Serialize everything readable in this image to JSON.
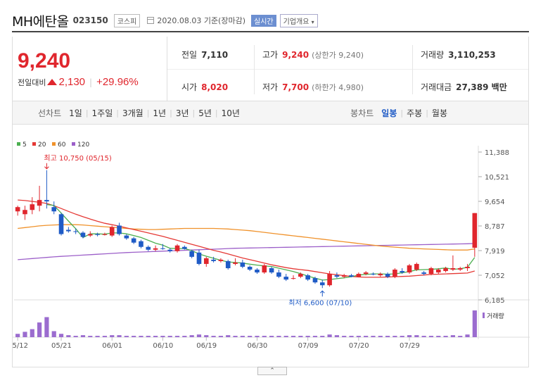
{
  "header": {
    "name": "MH에탄올",
    "code": "023150",
    "market": "코스피",
    "date": "2020.08.03 기준(장마감)",
    "realtime": "실시간",
    "company_info": "기업개요"
  },
  "summary": {
    "price": "9,240",
    "change_label": "전일대비",
    "change": "2,130",
    "change_pct": "+29.96%",
    "prev_close_label": "전일",
    "prev_close": "7,110",
    "open_label": "시가",
    "open": "8,020",
    "high_label": "고가",
    "high": "9,240",
    "high_limit": "(상한가 9,240)",
    "low_label": "저가",
    "low": "7,700",
    "low_limit": "(하한가 4,980)",
    "volume_label": "거래량",
    "volume": "3,110,253",
    "amount_label": "거래대금",
    "amount": "27,389 백만"
  },
  "tabs": {
    "line_label": "선차트",
    "periods": [
      "1일",
      "1주일",
      "3개월",
      "1년",
      "3년",
      "5년",
      "10년"
    ],
    "candle_label": "봉차트",
    "candles": [
      "일봉",
      "주봉",
      "월봉"
    ],
    "active_candle": "일봉"
  },
  "colors": {
    "up": "#e0262d",
    "down": "#1f5bc6",
    "ma5": "#4caf50",
    "ma20": "#e53935",
    "ma60": "#f0922b",
    "ma120": "#9c5fc9"
  },
  "chart_data": {
    "type": "candlestick",
    "legend": [
      "5",
      "20",
      "60",
      "120"
    ],
    "y_ticks": [
      "11,388",
      "10,521",
      "9,654",
      "8,787",
      "7,919",
      "7,052",
      "6,185"
    ],
    "ylim": [
      6185,
      11388
    ],
    "x_ticks": [
      "05/12",
      "05/21",
      "06/01",
      "06/10",
      "06/19",
      "06/30",
      "07/09",
      "07/20",
      "07/29"
    ],
    "annotations": {
      "max": "최고 10,750 (05/15)",
      "min": "최저 6,600 (07/10)"
    },
    "volume_label": "거래량",
    "candles": [
      {
        "o": 9300,
        "h": 9500,
        "l": 9150,
        "c": 9450
      },
      {
        "o": 9200,
        "h": 9500,
        "l": 9000,
        "c": 9350
      },
      {
        "o": 9350,
        "h": 9800,
        "l": 9200,
        "c": 9550
      },
      {
        "o": 9500,
        "h": 10200,
        "l": 9300,
        "c": 9700
      },
      {
        "o": 9700,
        "h": 10750,
        "l": 9400,
        "c": 9650
      },
      {
        "o": 9450,
        "h": 9650,
        "l": 9200,
        "c": 9300
      },
      {
        "o": 9200,
        "h": 9250,
        "l": 8450,
        "c": 8500
      },
      {
        "o": 8650,
        "h": 8750,
        "l": 8550,
        "c": 8600
      },
      {
        "o": 8600,
        "h": 8700,
        "l": 8500,
        "c": 8580
      },
      {
        "o": 8550,
        "h": 8600,
        "l": 8350,
        "c": 8400
      },
      {
        "o": 8450,
        "h": 8600,
        "l": 8400,
        "c": 8500
      },
      {
        "o": 8500,
        "h": 8550,
        "l": 8420,
        "c": 8470
      },
      {
        "o": 8470,
        "h": 8550,
        "l": 8450,
        "c": 8500
      },
      {
        "o": 8450,
        "h": 8800,
        "l": 8400,
        "c": 8750
      },
      {
        "o": 8800,
        "h": 8900,
        "l": 8450,
        "c": 8500
      },
      {
        "o": 8450,
        "h": 8500,
        "l": 8300,
        "c": 8350
      },
      {
        "o": 8350,
        "h": 8400,
        "l": 8150,
        "c": 8200
      },
      {
        "o": 8250,
        "h": 8300,
        "l": 8000,
        "c": 8050
      },
      {
        "o": 8050,
        "h": 8100,
        "l": 7900,
        "c": 7950
      },
      {
        "o": 7950,
        "h": 8100,
        "l": 7900,
        "c": 8000
      },
      {
        "o": 8000,
        "h": 8150,
        "l": 7950,
        "c": 7980
      },
      {
        "o": 7950,
        "h": 8000,
        "l": 7850,
        "c": 7900
      },
      {
        "o": 7900,
        "h": 8150,
        "l": 7850,
        "c": 8100
      },
      {
        "o": 8050,
        "h": 8100,
        "l": 7950,
        "c": 7980
      },
      {
        "o": 7900,
        "h": 7950,
        "l": 7650,
        "c": 7700
      },
      {
        "o": 7850,
        "h": 7950,
        "l": 7400,
        "c": 7450
      },
      {
        "o": 7450,
        "h": 7700,
        "l": 7350,
        "c": 7650
      },
      {
        "o": 7600,
        "h": 7700,
        "l": 7500,
        "c": 7550
      },
      {
        "o": 7550,
        "h": 7650,
        "l": 7500,
        "c": 7600
      },
      {
        "o": 7550,
        "h": 7600,
        "l": 7250,
        "c": 7300
      },
      {
        "o": 7450,
        "h": 7650,
        "l": 7400,
        "c": 7500
      },
      {
        "o": 7500,
        "h": 7600,
        "l": 7300,
        "c": 7350
      },
      {
        "o": 7350,
        "h": 7400,
        "l": 7200,
        "c": 7250
      },
      {
        "o": 7250,
        "h": 7300,
        "l": 7100,
        "c": 7150
      },
      {
        "o": 7150,
        "h": 7450,
        "l": 7100,
        "c": 7400
      },
      {
        "o": 7300,
        "h": 7350,
        "l": 7100,
        "c": 7150
      },
      {
        "o": 7150,
        "h": 7250,
        "l": 6950,
        "c": 7000
      },
      {
        "o": 7000,
        "h": 7100,
        "l": 6850,
        "c": 6900
      },
      {
        "o": 6950,
        "h": 7050,
        "l": 6900,
        "c": 6950
      },
      {
        "o": 7000,
        "h": 7150,
        "l": 6950,
        "c": 7100
      },
      {
        "o": 7050,
        "h": 7100,
        "l": 6850,
        "c": 6900
      },
      {
        "o": 6950,
        "h": 7000,
        "l": 6750,
        "c": 6800
      },
      {
        "o": 6800,
        "h": 6900,
        "l": 6600,
        "c": 6700
      },
      {
        "o": 6700,
        "h": 7200,
        "l": 6650,
        "c": 7100
      },
      {
        "o": 7050,
        "h": 7150,
        "l": 6950,
        "c": 7000
      },
      {
        "o": 7000,
        "h": 7100,
        "l": 6950,
        "c": 7050
      },
      {
        "o": 7050,
        "h": 7100,
        "l": 6980,
        "c": 7000
      },
      {
        "o": 7000,
        "h": 7150,
        "l": 6980,
        "c": 7100
      },
      {
        "o": 7100,
        "h": 7200,
        "l": 7050,
        "c": 7150
      },
      {
        "o": 7100,
        "h": 7150,
        "l": 7050,
        "c": 7080
      },
      {
        "o": 7050,
        "h": 7150,
        "l": 7000,
        "c": 7100
      },
      {
        "o": 7100,
        "h": 7150,
        "l": 6950,
        "c": 7000
      },
      {
        "o": 7000,
        "h": 7300,
        "l": 6950,
        "c": 7250
      },
      {
        "o": 7200,
        "h": 7300,
        "l": 7100,
        "c": 7150
      },
      {
        "o": 7150,
        "h": 7450,
        "l": 7100,
        "c": 7400
      },
      {
        "o": 7250,
        "h": 7500,
        "l": 7200,
        "c": 7450
      },
      {
        "o": 7150,
        "h": 7200,
        "l": 7050,
        "c": 7100
      },
      {
        "o": 7100,
        "h": 7350,
        "l": 7050,
        "c": 7300
      },
      {
        "o": 7150,
        "h": 7300,
        "l": 7100,
        "c": 7250
      },
      {
        "o": 7200,
        "h": 7350,
        "l": 7150,
        "c": 7300
      },
      {
        "o": 7250,
        "h": 7750,
        "l": 7200,
        "c": 7300
      },
      {
        "o": 7250,
        "h": 7350,
        "l": 7200,
        "c": 7300
      },
      {
        "o": 7300,
        "h": 7450,
        "l": 7200,
        "c": 7350
      },
      {
        "o": 8020,
        "h": 9240,
        "l": 7700,
        "c": 9240
      }
    ],
    "volume": [
      5,
      8,
      12,
      22,
      30,
      9,
      5,
      3,
      2,
      3,
      2,
      2,
      2,
      3,
      3,
      2,
      2,
      2,
      2,
      2,
      2,
      2,
      2,
      2,
      3,
      4,
      3,
      2,
      2,
      3,
      2,
      2,
      2,
      2,
      2,
      2,
      2,
      2,
      2,
      2,
      2,
      2,
      2,
      4,
      3,
      2,
      2,
      2,
      2,
      2,
      2,
      2,
      2,
      2,
      3,
      3,
      2,
      2,
      2,
      2,
      3,
      2,
      4,
      40
    ],
    "ma5": [
      null,
      null,
      null,
      null,
      9540,
      9510,
      9240,
      8960,
      8690,
      8380,
      8510,
      8510,
      8500,
      8540,
      8540,
      8510,
      8450,
      8380,
      8280,
      8180,
      8110,
      8000,
      7990,
      7990,
      7920,
      7800,
      7720,
      7650,
      7580,
      7520,
      7500,
      7480,
      7440,
      7410,
      7380,
      7360,
      7300,
      7240,
      7180,
      7110,
      7020,
      6950,
      6880,
      6900,
      6930,
      6960,
      7000,
      7060,
      7080,
      7100,
      7100,
      7090,
      7100,
      7140,
      7180,
      7240,
      7250,
      7260,
      7280,
      7310,
      7260,
      7280,
      7330,
      7680
    ],
    "ma20": [
      9700,
      9680,
      9650,
      9620,
      9580,
      9500,
      9400,
      9300,
      9200,
      9110,
      9030,
      8950,
      8880,
      8830,
      8780,
      8720,
      8660,
      8600,
      8540,
      8480,
      8420,
      8350,
      8280,
      8210,
      8140,
      8070,
      8000,
      7930,
      7870,
      7800,
      7730,
      7660,
      7600,
      7540,
      7480,
      7420,
      7370,
      7320,
      7280,
      7250,
      7220,
      7180,
      7140,
      7100,
      7070,
      7040,
      7010,
      6990,
      6980,
      6980,
      6980,
      6990,
      7000,
      7010,
      7020,
      7040,
      7060,
      7080,
      7090,
      7100,
      7110,
      7120,
      7130,
      7200
    ],
    "ma60": [
      8700,
      8730,
      8760,
      8790,
      8810,
      8820,
      8830,
      8830,
      8830,
      8820,
      8800,
      8780,
      8760,
      8740,
      8720,
      8700,
      8680,
      8670,
      8660,
      8660,
      8670,
      8680,
      8690,
      8700,
      8700,
      8700,
      8700,
      8700,
      8690,
      8680,
      8660,
      8640,
      8620,
      8590,
      8560,
      8530,
      8500,
      8470,
      8440,
      8410,
      8380,
      8350,
      8320,
      8290,
      8260,
      8230,
      8200,
      8170,
      8140,
      8110,
      8080,
      8060,
      8040,
      8020,
      8000,
      7990,
      7980,
      7970,
      7960,
      7950,
      7940,
      7940,
      7940,
      7980
    ],
    "ma120": [
      7600,
      7620,
      7640,
      7660,
      7680,
      7700,
      7715,
      7730,
      7745,
      7760,
      7775,
      7790,
      7805,
      7820,
      7835,
      7850,
      7860,
      7870,
      7880,
      7890,
      7900,
      7910,
      7920,
      7930,
      7940,
      7950,
      7960,
      7970,
      7980,
      7990,
      8000,
      8005,
      8010,
      8015,
      8020,
      8025,
      8030,
      8035,
      8040,
      8045,
      8050,
      8055,
      8060,
      8065,
      8070,
      8075,
      8080,
      8085,
      8090,
      8095,
      8100,
      8105,
      8110,
      8115,
      8120,
      8125,
      8130,
      8135,
      8140,
      8145,
      8150,
      8155,
      8160,
      8170
    ]
  }
}
